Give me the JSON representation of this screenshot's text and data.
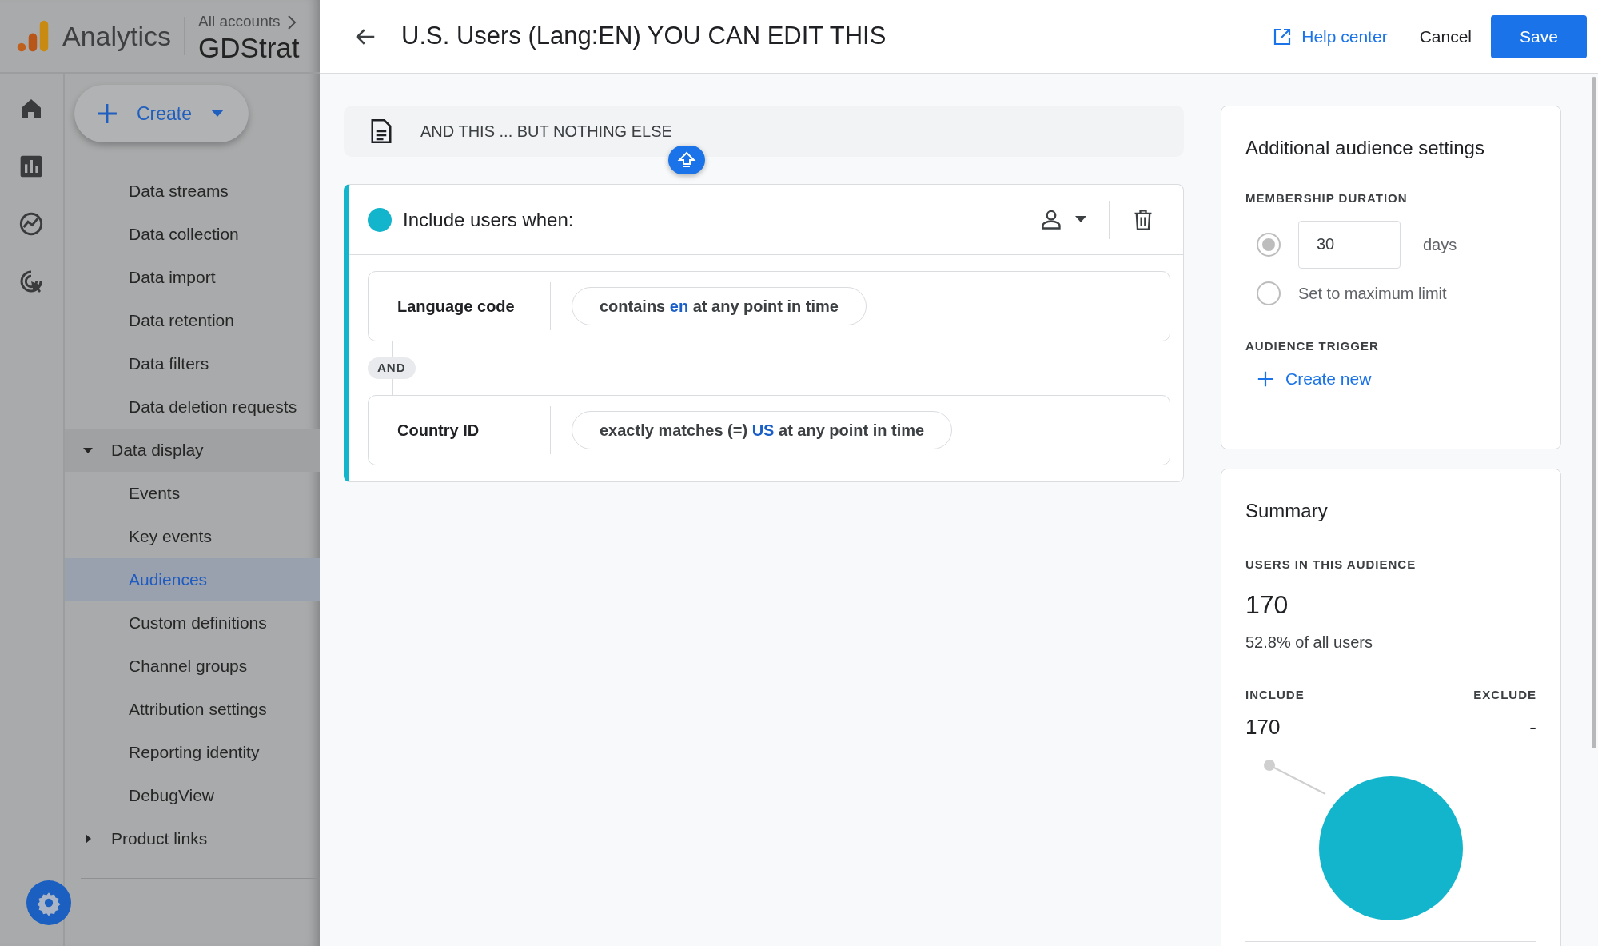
{
  "app": {
    "name": "Analytics",
    "breadcrumb": "All accounts",
    "property": "GDStrat"
  },
  "create_button": {
    "label": "Create"
  },
  "nav_groups": [
    {
      "items": [
        {
          "label": "Data streams",
          "selected": false
        },
        {
          "label": "Data collection",
          "selected": false
        },
        {
          "label": "Data import",
          "selected": false
        },
        {
          "label": "Data retention",
          "selected": false
        },
        {
          "label": "Data filters",
          "selected": false
        },
        {
          "label": "Data deletion requests",
          "selected": false
        }
      ]
    },
    {
      "label": "Data display",
      "expanded": true,
      "items": [
        {
          "label": "Events",
          "selected": false
        },
        {
          "label": "Key events",
          "selected": false
        },
        {
          "label": "Audiences",
          "selected": true
        },
        {
          "label": "Custom definitions",
          "selected": false
        },
        {
          "label": "Channel groups",
          "selected": false
        },
        {
          "label": "Attribution settings",
          "selected": false
        },
        {
          "label": "Reporting identity",
          "selected": false
        },
        {
          "label": "DebugView",
          "selected": false
        }
      ]
    },
    {
      "label": "Product links",
      "expanded": false
    }
  ],
  "header": {
    "title": "U.S. Users (Lang:EN) YOU CAN EDIT THIS",
    "help": "Help center",
    "cancel": "Cancel",
    "save": "Save"
  },
  "description": "AND THIS ... BUT NOTHING ELSE",
  "condition_group": {
    "title": "Include users when:",
    "connector": "AND",
    "conditions": [
      {
        "field": "Language code",
        "operator": "contains",
        "value": "en",
        "suffix": "at any point in time"
      },
      {
        "field": "Country ID",
        "operator": "exactly matches (=)",
        "value": "US",
        "suffix": "at any point in time"
      }
    ]
  },
  "settings": {
    "title": "Additional audience settings",
    "membership_label": "MEMBERSHIP DURATION",
    "options": [
      {
        "kind": "days",
        "value": "30",
        "unit": "days",
        "selected": true
      },
      {
        "kind": "max",
        "label": "Set to maximum limit",
        "selected": false
      }
    ],
    "trigger_label": "AUDIENCE TRIGGER",
    "trigger_action": "Create new"
  },
  "summary": {
    "title": "Summary",
    "users_label": "USERS IN THIS AUDIENCE",
    "users": "170",
    "share": "52.8% of all users",
    "include_label": "INCLUDE",
    "include": "170",
    "exclude_label": "EXCLUDE",
    "exclude": "-"
  }
}
